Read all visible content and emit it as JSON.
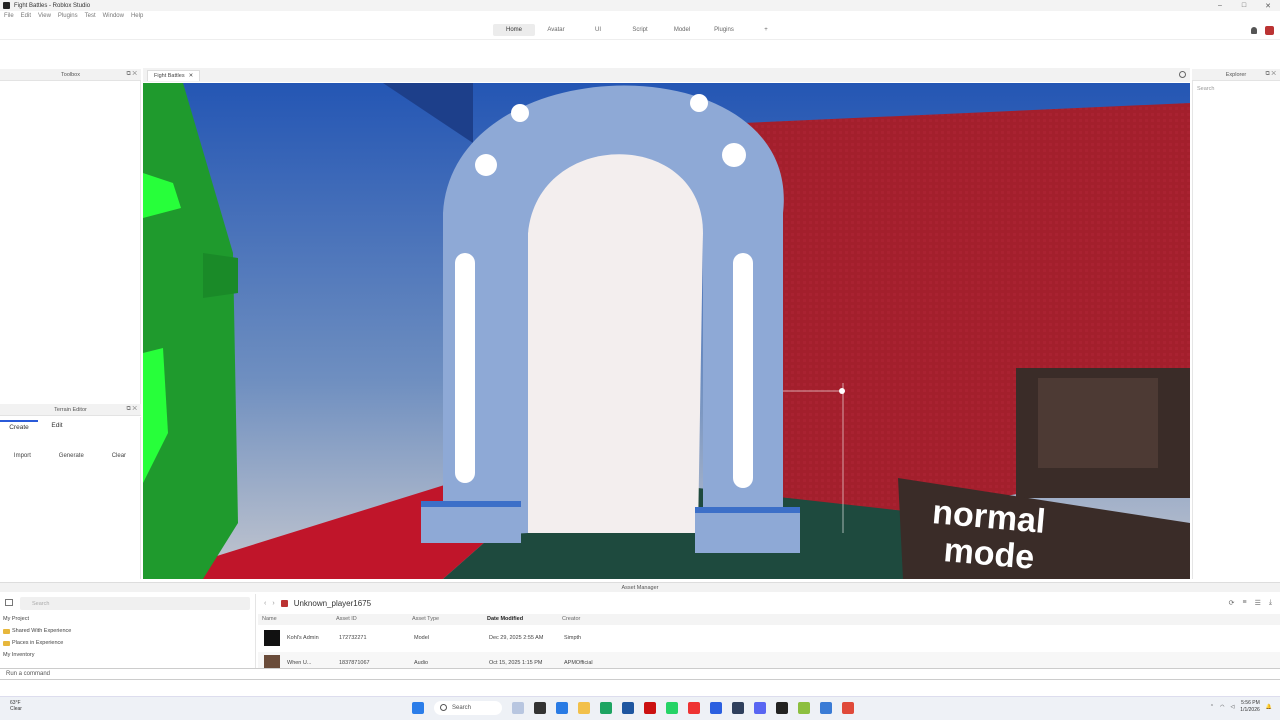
{
  "window": {
    "title": "Fight Battles - Roblox Studio"
  },
  "menu": [
    "File",
    "Edit",
    "View",
    "Plugins",
    "Test",
    "Window",
    "Help"
  ],
  "ribbon": {
    "tabs": [
      "Home",
      "Avatar",
      "UI",
      "Script",
      "Model",
      "Plugins",
      "+"
    ],
    "active": "Home"
  },
  "panels": {
    "toolbox": "Toolbox",
    "explorer": "Explorer",
    "explorer_search": "Search",
    "terrain_editor": "Terrain Editor",
    "asset_manager": "Asset Manager"
  },
  "document_tab": "Fight Battles",
  "terrain": {
    "tabs": [
      "Create",
      "Edit"
    ],
    "actions": [
      "Import",
      "Generate",
      "Clear"
    ]
  },
  "viewport": {
    "sign_text": [
      "normal",
      "mode"
    ]
  },
  "asset_manager": {
    "search_placeholder": "Search",
    "tree": [
      "My Project",
      "Shared With Experience",
      "Places in Experience",
      "My Inventory"
    ],
    "breadcrumb": "Unknown_player1675",
    "columns": [
      "Name",
      "Asset ID",
      "Asset Type",
      "Date Modified",
      "Creator"
    ],
    "rows": [
      {
        "name": "Kohl's Admin",
        "id": "172732271",
        "type": "Model",
        "date": "Dec 29, 2025 2:55 AM",
        "creator": "Simpth"
      },
      {
        "name": "When U...",
        "id": "1837871067",
        "type": "Audio",
        "date": "Oct 15, 2025 1:15 PM",
        "creator": "APMOfficial"
      }
    ]
  },
  "command_bar": {
    "placeholder": "Run a command"
  },
  "taskbar": {
    "weather_temp": "63°F",
    "weather_desc": "Clear",
    "search": "Search",
    "time": "5:56 PM",
    "date": "1/1/2026"
  }
}
